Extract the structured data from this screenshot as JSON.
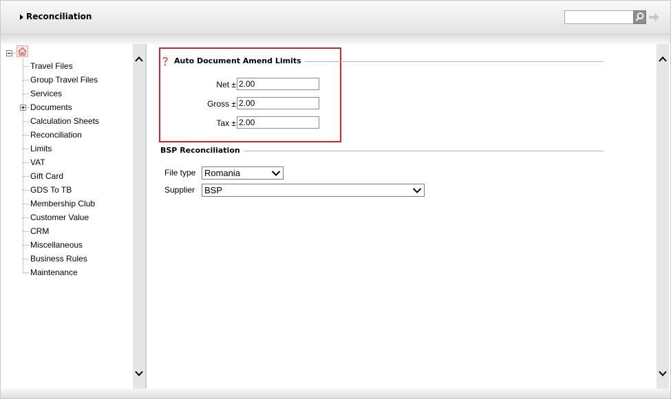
{
  "header": {
    "title": "Reconciliation",
    "search": {
      "value": "",
      "placeholder": ""
    }
  },
  "tree": {
    "items": [
      {
        "label": "Travel Files"
      },
      {
        "label": "Group Travel Files"
      },
      {
        "label": "Services"
      },
      {
        "label": "Documents",
        "expandable": true
      },
      {
        "label": "Calculation Sheets"
      },
      {
        "label": "Reconciliation"
      },
      {
        "label": "Limits"
      },
      {
        "label": "VAT"
      },
      {
        "label": "Gift Card"
      },
      {
        "label": "GDS To TB"
      },
      {
        "label": "Membership Club"
      },
      {
        "label": "Customer Value"
      },
      {
        "label": "CRM"
      },
      {
        "label": "Miscellaneous"
      },
      {
        "label": "Business Rules"
      },
      {
        "label": "Maintenance"
      }
    ]
  },
  "auto_amend": {
    "title": "Auto Document Amend Limits",
    "net": {
      "label": "Net ±",
      "value": "2.00"
    },
    "gross": {
      "label": "Gross ±",
      "value": "2.00"
    },
    "tax": {
      "label": "Tax ±",
      "value": "2.00"
    }
  },
  "bsp": {
    "title": "BSP Reconciliation",
    "file_type": {
      "label": "File type",
      "value": "Romania"
    },
    "supplier": {
      "label": "Supplier",
      "value": "BSP"
    }
  },
  "colors": {
    "highlight": "#d6212a",
    "scroll_bg": "#e6e6e6"
  }
}
